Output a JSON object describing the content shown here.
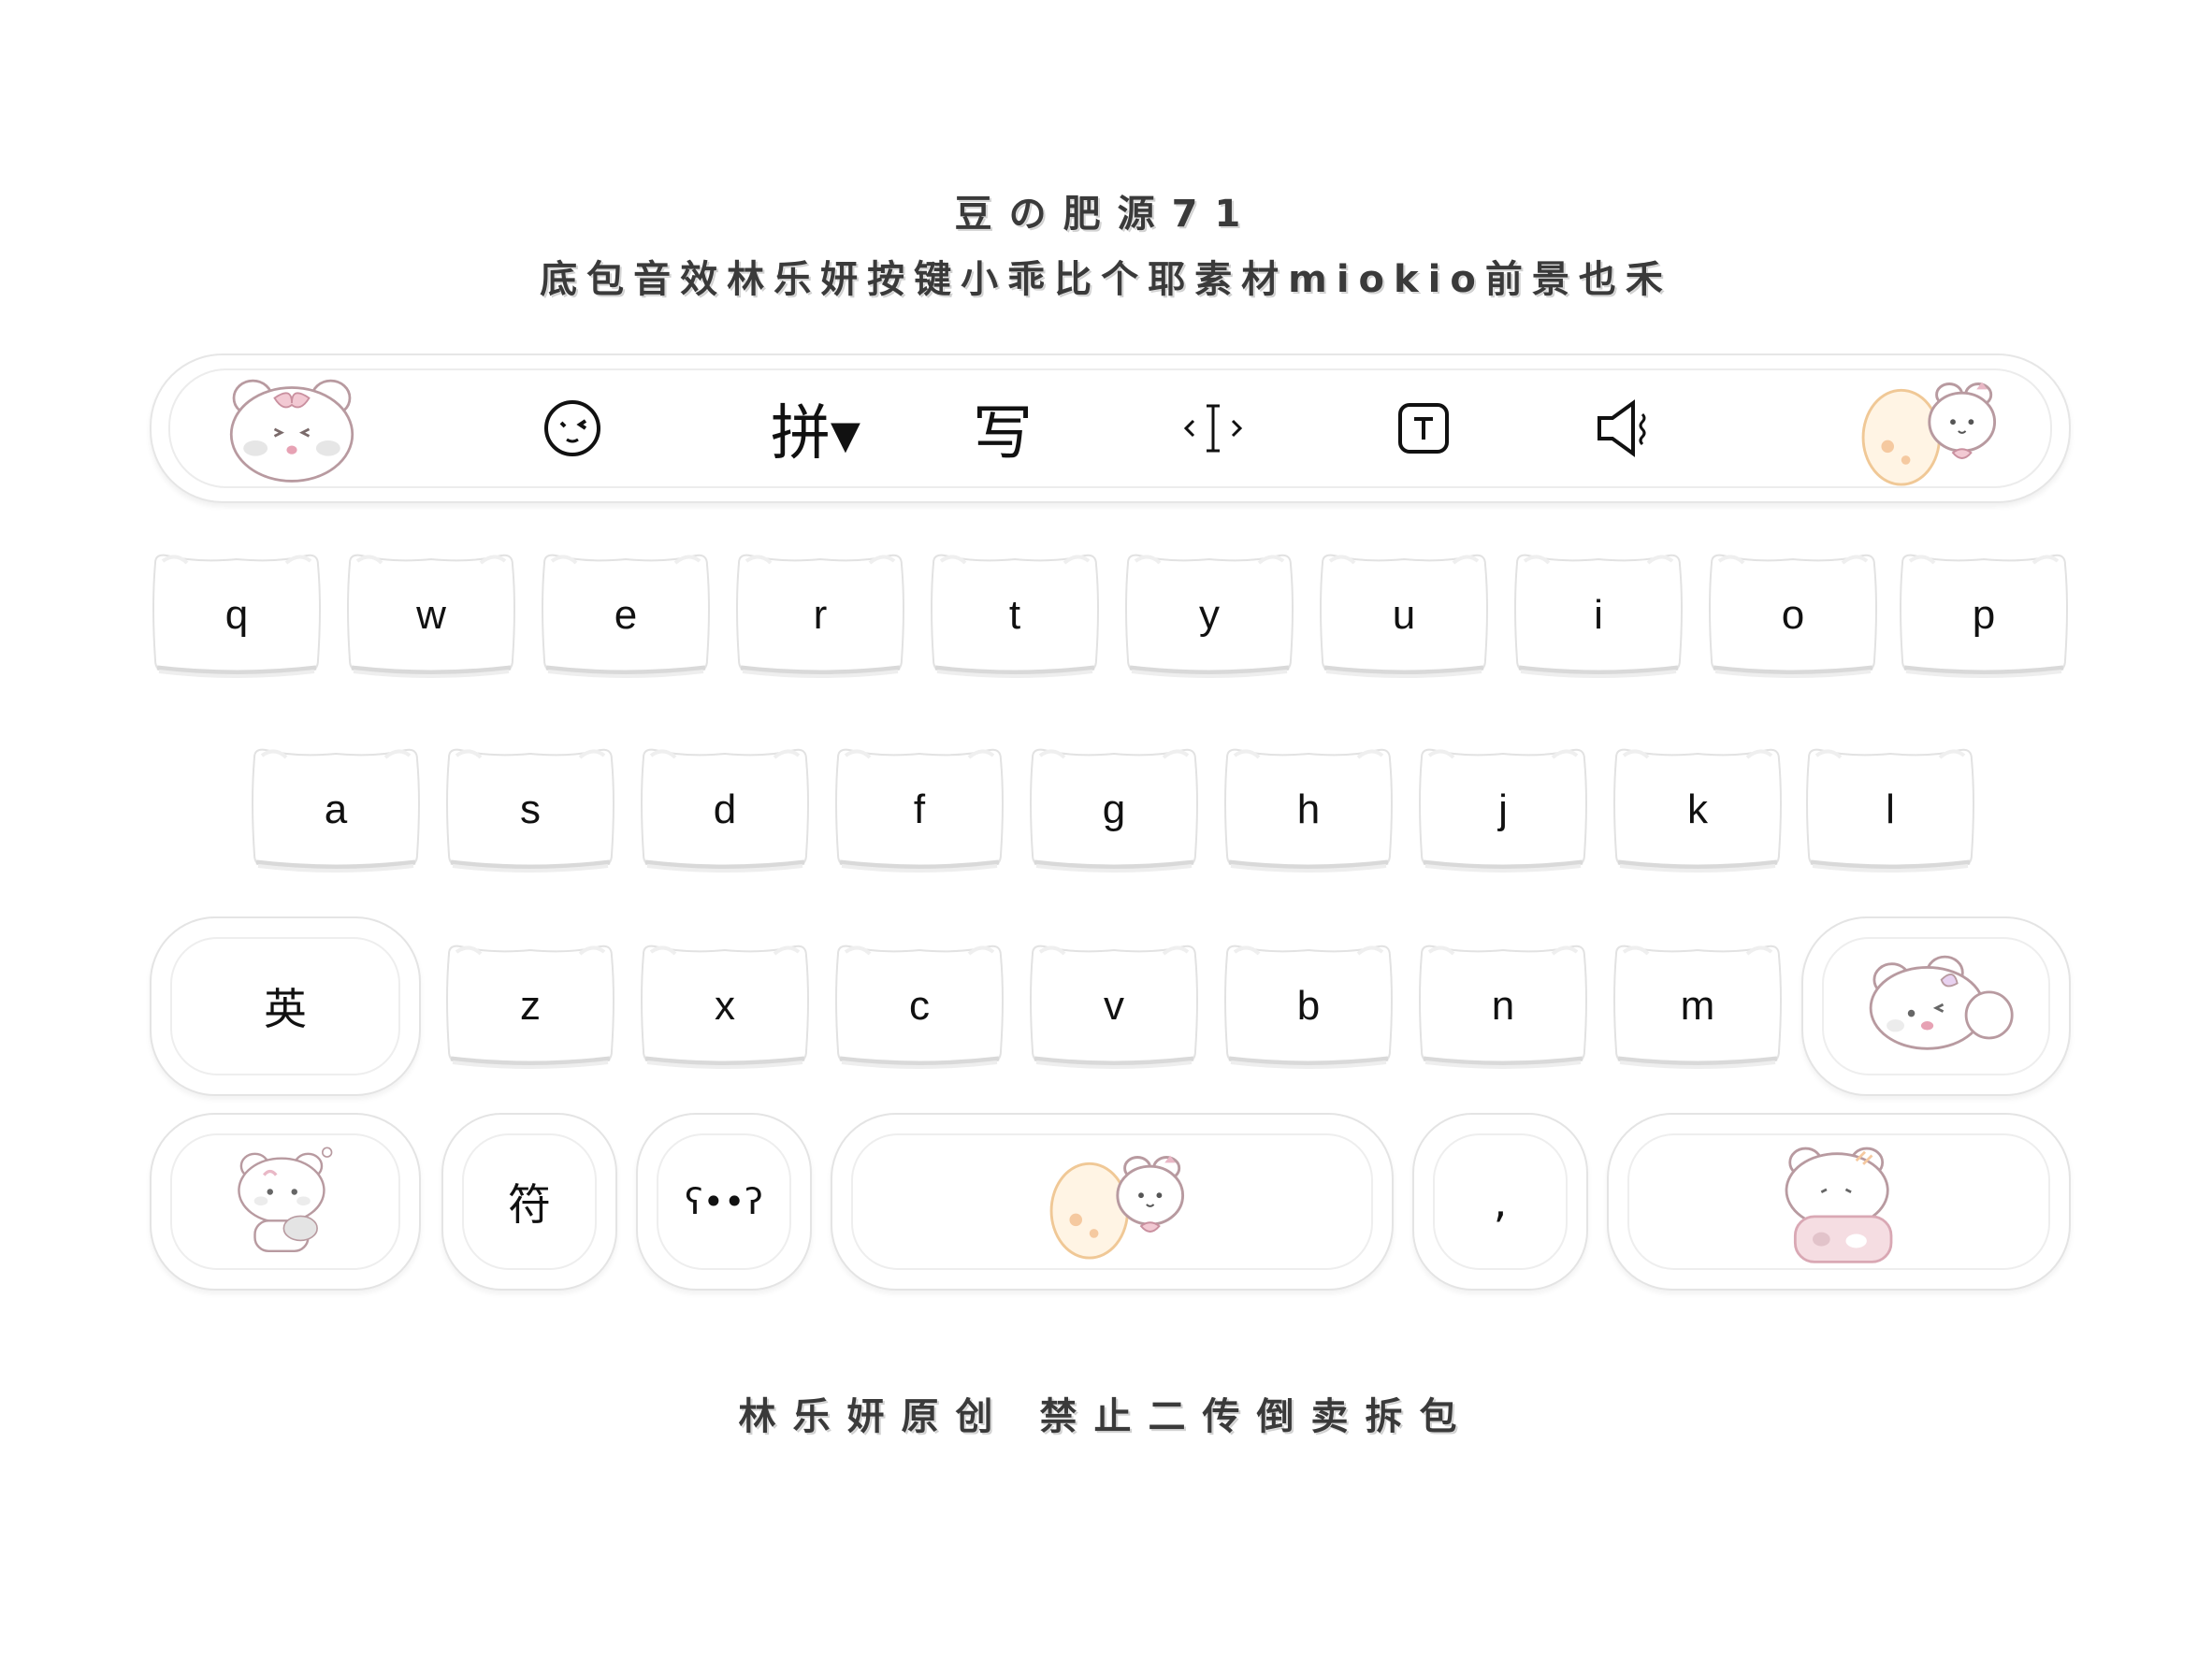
{
  "header": {
    "title_line1": "豆の肥源71",
    "title_line2": "底包音效林乐妍按键小乖比个耶素材miokio前景也禾"
  },
  "toolbar": {
    "pinyin_label": "拼▾",
    "handwrite_label": "写",
    "icons": [
      "bear-avatar-icon",
      "emoji-face-icon",
      "cursor-move-icon",
      "text-box-icon",
      "speaker-icon",
      "bear-egg-icon"
    ]
  },
  "keyboard": {
    "row1": [
      "q",
      "w",
      "e",
      "r",
      "t",
      "y",
      "u",
      "i",
      "o",
      "p"
    ],
    "row2": [
      "a",
      "s",
      "d",
      "f",
      "g",
      "h",
      "j",
      "k",
      "l"
    ],
    "row3": [
      "z",
      "x",
      "c",
      "v",
      "b",
      "n",
      "m"
    ],
    "lang_key": "英",
    "symbol_key": "符",
    "emoticon_key": "ʕ••ʔ",
    "comma_key": ","
  },
  "footer": {
    "text": "林乐妍原创  禁止二传倒卖拆包"
  },
  "colors": {
    "key_border": "#e4e4e4",
    "bear_pink": "#f2c9d3",
    "bear_outline": "#b89aa0",
    "egg_orange": "#f6d7a8"
  }
}
